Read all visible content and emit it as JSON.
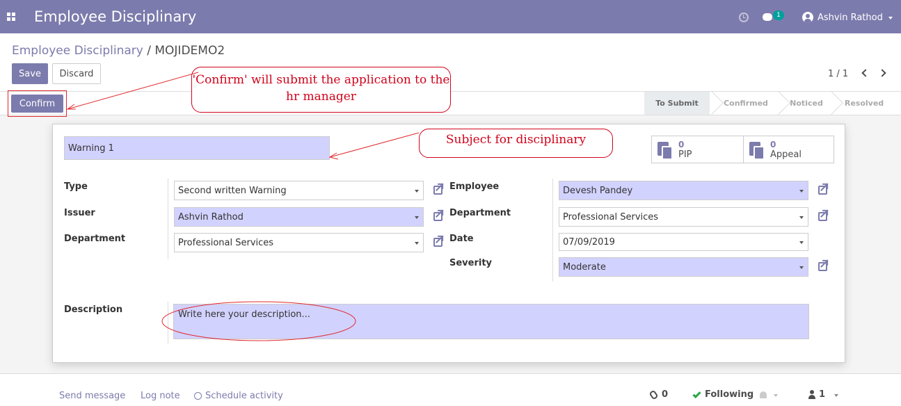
{
  "topbar": {
    "app_title": "Employee Disciplinary",
    "chat_count": "1",
    "user_name": "Ashvin Rathod"
  },
  "breadcrumb": {
    "parent": "Employee Disciplinary",
    "separator": "/",
    "current": "MOJIDEMO2"
  },
  "buttons": {
    "save": "Save",
    "discard": "Discard",
    "confirm": "Confirm"
  },
  "pager": {
    "value": "1 / 1"
  },
  "status": {
    "stages": [
      "To Submit",
      "Confirmed",
      "Noticed",
      "Resolved"
    ],
    "active": "To Submit"
  },
  "form": {
    "name": "Warning 1",
    "smart_buttons": [
      {
        "count": "0",
        "label": "PIP"
      },
      {
        "count": "0",
        "label": "Appeal"
      }
    ],
    "left": {
      "type_label": "Type",
      "type_value": "Second written Warning",
      "issuer_label": "Issuer",
      "issuer_value": "Ashvin Rathod",
      "department_label": "Department",
      "department_value": "Professional Services"
    },
    "right": {
      "employee_label": "Employee",
      "employee_value": "Devesh Pandey",
      "department_label": "Department",
      "department_value": "Professional Services",
      "date_label": "Date",
      "date_value": "07/09/2019",
      "severity_label": "Severity",
      "severity_value": "Moderate"
    },
    "description_label": "Description",
    "description_placeholder": "Write here your description..."
  },
  "chatter": {
    "send_message": "Send message",
    "log_note": "Log note",
    "schedule_activity": "Schedule activity",
    "attachments": "0",
    "following": "Following",
    "followers": "1"
  },
  "annotations": {
    "confirm_note": "'Confirm' will submit the application to the hr manager",
    "subject_note": "Subject for disciplinary"
  },
  "colors": {
    "brand": "#7c7bad",
    "highlight_field": "#d2d2ff",
    "annotation_red": "#d0021b",
    "following_green": "#28a745"
  }
}
